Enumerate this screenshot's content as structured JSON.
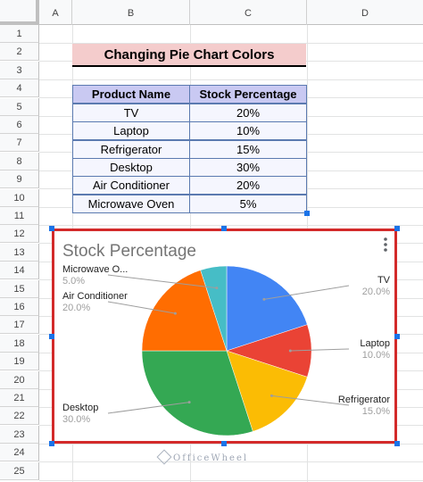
{
  "columns": [
    "A",
    "B",
    "C",
    "D"
  ],
  "rows": [
    "1",
    "2",
    "3",
    "4",
    "5",
    "6",
    "7",
    "8",
    "9",
    "10",
    "11",
    "12",
    "13",
    "14",
    "15",
    "16",
    "17",
    "18",
    "19",
    "20",
    "21",
    "22",
    "23",
    "24",
    "25"
  ],
  "title": "Changing Pie Chart Colors",
  "table": {
    "headers": [
      "Product Name",
      "Stock Percentage"
    ],
    "rows": [
      [
        "TV",
        "20%"
      ],
      [
        "Laptop",
        "10%"
      ],
      [
        "Refrigerator",
        "15%"
      ],
      [
        "Desktop",
        "30%"
      ],
      [
        "Air Conditioner",
        "20%"
      ],
      [
        "Microwave Oven",
        "5%"
      ]
    ]
  },
  "chart_data": {
    "type": "pie",
    "title": "Stock Percentage",
    "categories": [
      "TV",
      "Laptop",
      "Refrigerator",
      "Desktop",
      "Air Conditioner",
      "Microwave Oven"
    ],
    "values": [
      20,
      10,
      15,
      30,
      20,
      5
    ],
    "labels": [
      "TV",
      "Laptop",
      "Refrigerator",
      "Desktop",
      "Air Conditioner",
      "Microwave O..."
    ],
    "percent_labels": [
      "20.0%",
      "10.0%",
      "15.0%",
      "30.0%",
      "20.0%",
      "5.0%"
    ],
    "colors": [
      "#4285f4",
      "#ea4335",
      "#fbbc04",
      "#34a853",
      "#ff6d01",
      "#46bdc6"
    ],
    "legend": "labeled slices"
  },
  "chart_menu_icon": "more-vert-icon",
  "watermark": "OfficeWheel"
}
